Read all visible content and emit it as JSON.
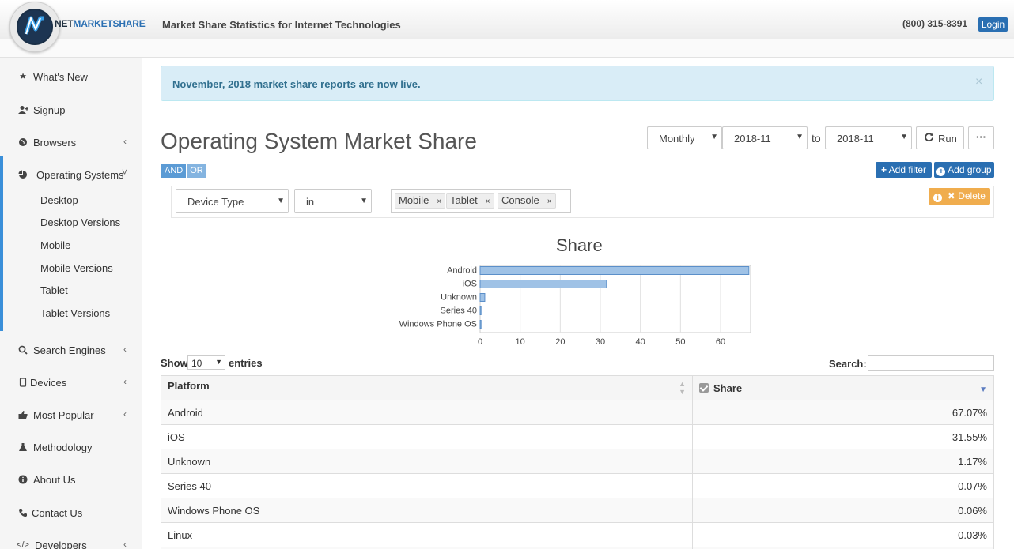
{
  "header": {
    "brand_part1": "NET",
    "brand_part2": "MARKETSHARE",
    "tagline": "Market Share Statistics for Internet Technologies",
    "phone": "(800) 315-8391",
    "login_label": "Login"
  },
  "sidebar": {
    "items": [
      {
        "label": "What's New",
        "icon": "star-icon"
      },
      {
        "label": "Signup",
        "icon": "add-user-icon"
      },
      {
        "label": "Browsers",
        "icon": "globe-icon"
      },
      {
        "label": "Operating Systems",
        "icon": "pie-chart-icon"
      },
      {
        "label": "Search Engines",
        "icon": "search-icon"
      },
      {
        "label": "Devices",
        "icon": "tablet-icon"
      },
      {
        "label": "Most Popular",
        "icon": "thumbs-up-icon"
      },
      {
        "label": "Methodology",
        "icon": "flask-icon"
      },
      {
        "label": "About Us",
        "icon": "info-icon"
      },
      {
        "label": "Contact Us",
        "icon": "phone-icon"
      },
      {
        "label": "Developers",
        "icon": "code-icon"
      }
    ],
    "subitems": [
      "Desktop",
      "Desktop Versions",
      "Mobile",
      "Mobile Versions",
      "Tablet",
      "Tablet Versions"
    ]
  },
  "alert": {
    "text": "November, 2018 market share reports are now live.",
    "close": "×"
  },
  "page": {
    "title": "Operating System Market Share"
  },
  "controls": {
    "period": "Monthly",
    "from": "2018-11",
    "to_label": "to",
    "to": "2018-11",
    "run_label": "Run",
    "more_label": "···"
  },
  "query": {
    "and_label": "AND",
    "or_label": "OR",
    "field": "Device Type",
    "operator": "in",
    "tags": [
      "Mobile",
      "Tablet",
      "Console"
    ],
    "add_filter_label": "Add filter",
    "add_group_label": "Add group",
    "delete_label": "Delete"
  },
  "chart_data": {
    "type": "bar",
    "title": "Share",
    "categories": [
      "Android",
      "iOS",
      "Unknown",
      "Series 40",
      "Windows Phone OS"
    ],
    "values": [
      67.07,
      31.55,
      1.17,
      0.07,
      0.06
    ],
    "xticks": [
      "0",
      "10",
      "20",
      "30",
      "40",
      "50",
      "60"
    ],
    "xlim": [
      0,
      67.5
    ],
    "grid": true,
    "bar_color": "#9fc2e6",
    "bar_stroke": "#5b8fc9"
  },
  "table": {
    "show_label": "Show",
    "entries_value": "10",
    "entries_label": "entries",
    "search_label": "Search:",
    "columns": [
      "Platform",
      "Share"
    ],
    "rows": [
      [
        "Android",
        "67.07%"
      ],
      [
        "iOS",
        "31.55%"
      ],
      [
        "Unknown",
        "1.17%"
      ],
      [
        "Series 40",
        "0.07%"
      ],
      [
        "Windows Phone OS",
        "0.06%"
      ],
      [
        "Linux",
        "0.03%"
      ]
    ]
  }
}
